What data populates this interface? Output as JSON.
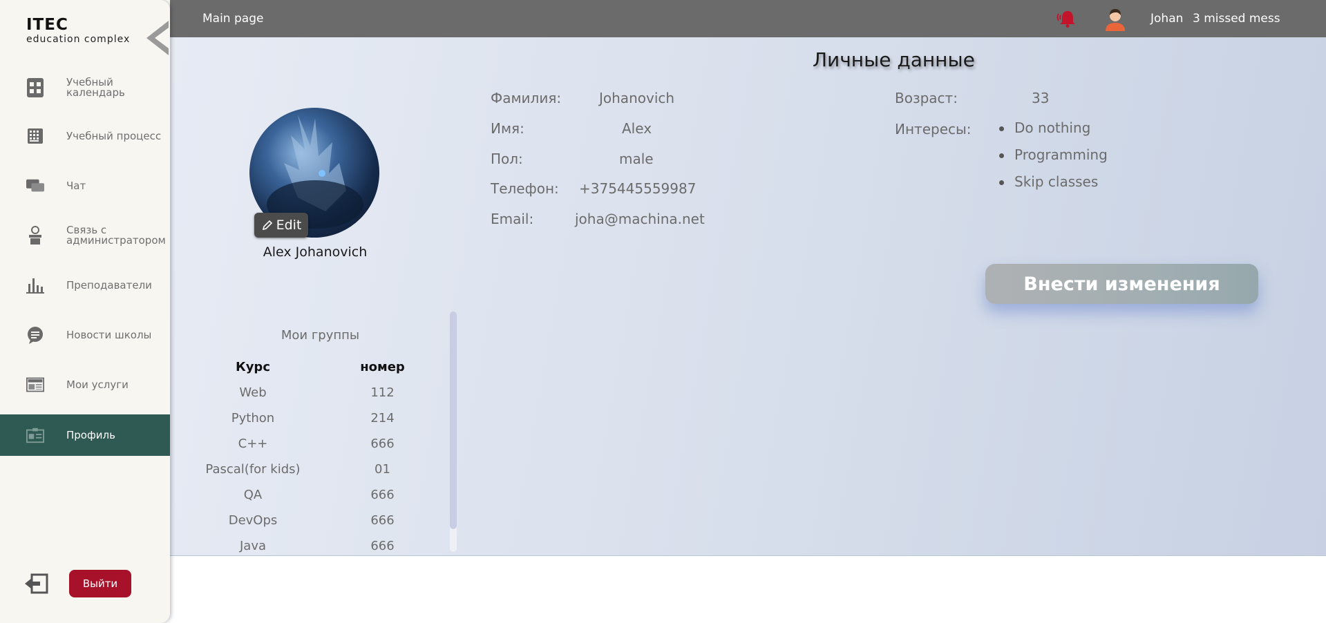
{
  "sidebar": {
    "logo_title": "ITEC",
    "logo_sub": "education complex",
    "items": [
      {
        "label": "Учебный календарь",
        "icon": "calendar-grid-icon"
      },
      {
        "label": "Учебный процесс",
        "icon": "calculator-icon"
      },
      {
        "label": "Чат",
        "icon": "chat-icon"
      },
      {
        "label": "Связь с администратором",
        "icon": "admin-icon"
      },
      {
        "label": "Преподаватели",
        "icon": "bar-chart-icon"
      },
      {
        "label": "Новости школы",
        "icon": "news-bubble-icon"
      },
      {
        "label": "Мои услуги",
        "icon": "newspaper-icon"
      },
      {
        "label": "Профиль",
        "icon": "id-card-icon"
      }
    ],
    "active_item": "Профиль",
    "logout_label": "Выйти"
  },
  "topbar": {
    "title": "Main page",
    "username": "Johan",
    "missed": "3 missed mess"
  },
  "profile": {
    "section_title": "Личные данные",
    "edit_label": "Edit",
    "name": "Alex Johanovich",
    "fields": {
      "surname_label": "Фамилия:",
      "surname": "Johanovich",
      "name_label": "Имя:",
      "name": "Alex",
      "gender_label": "Пол:",
      "gender": "male",
      "phone_label": "Телефон:",
      "phone": "+375445559987",
      "email_label": "Email:",
      "email": "joha@machina.net"
    },
    "age_label": "Возраст:",
    "age": "33",
    "interests_label": "Интересы:",
    "interests": [
      "Do nothing",
      "Programming",
      "Skip classes"
    ],
    "save_label": "Внести изменения"
  },
  "groups": {
    "title": "Мои группы",
    "headers": [
      "Курс",
      "номер"
    ],
    "rows": [
      [
        "Web",
        "112"
      ],
      [
        "Python",
        "214"
      ],
      [
        "C++",
        "666"
      ],
      [
        "Pascal(for kids)",
        "01"
      ],
      [
        "QA",
        "666"
      ],
      [
        "DevOps",
        "666"
      ],
      [
        "Java",
        "666"
      ]
    ]
  },
  "colors": {
    "sidebar_active": "#2f5a53",
    "topbar": "#6b6b6b",
    "logout": "#a8112a",
    "bell": "#c4142b"
  }
}
